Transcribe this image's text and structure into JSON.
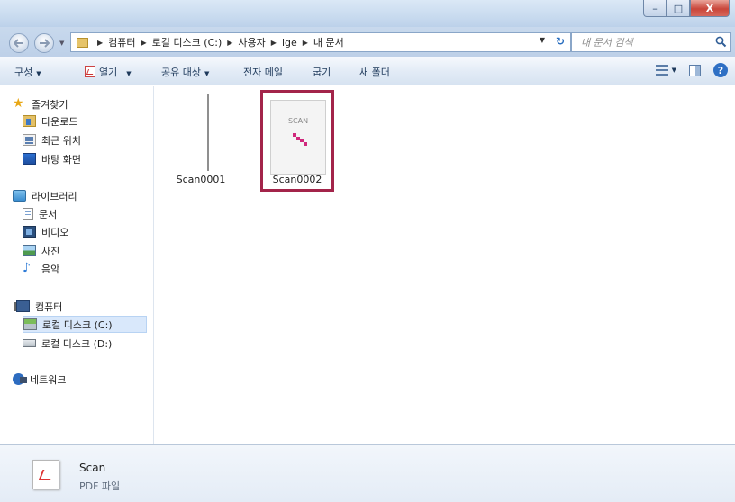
{
  "window": {
    "buttons": {
      "minimize": "–",
      "maximize": "□",
      "close": "X"
    }
  },
  "navigation": {
    "back_icon": "back-arrow-icon",
    "forward_icon": "forward-arrow-icon"
  },
  "address_bar": {
    "crumbs": [
      "컴퓨터",
      "로컬 디스크 (C:)",
      "사용자",
      "lge",
      "내 문서"
    ]
  },
  "search": {
    "placeholder": "내 문서 검색"
  },
  "toolbar": {
    "organize": "구성",
    "open": "열기",
    "share": "공유 대상",
    "email": "전자 메일",
    "burn": "굽기",
    "new_folder": "새 폴더",
    "help": "?"
  },
  "sidebar": {
    "favorites": {
      "label": "즐겨찾기",
      "items": [
        {
          "label": "다운로드",
          "icon": "download-folder-icon"
        },
        {
          "label": "최근 위치",
          "icon": "recent-places-icon"
        },
        {
          "label": "바탕 화면",
          "icon": "desktop-icon"
        }
      ]
    },
    "libraries": {
      "label": "라이브러리",
      "items": [
        {
          "label": "문서",
          "icon": "documents-icon"
        },
        {
          "label": "비디오",
          "icon": "video-icon"
        },
        {
          "label": "사진",
          "icon": "pictures-icon"
        },
        {
          "label": "음악",
          "icon": "music-icon"
        }
      ]
    },
    "computer": {
      "label": "컴퓨터",
      "items": [
        {
          "label": "로컬 디스크 (C:)",
          "icon": "drive-c-icon",
          "selected": true
        },
        {
          "label": "로컬 디스크 (D:)",
          "icon": "drive-d-icon",
          "selected": false
        }
      ]
    },
    "network": {
      "label": "네트워크"
    }
  },
  "files": [
    {
      "name": "Scan0001",
      "selected": false
    },
    {
      "name": "Scan0002",
      "selected": true,
      "thumb_text": "SCAN"
    }
  ],
  "details": {
    "name": "Scan",
    "type": "PDF 파일"
  },
  "colors": {
    "selection_border": "#a3244a",
    "toolbar_text": "#1e395b",
    "thumbnail_mark": "#d0287c"
  }
}
